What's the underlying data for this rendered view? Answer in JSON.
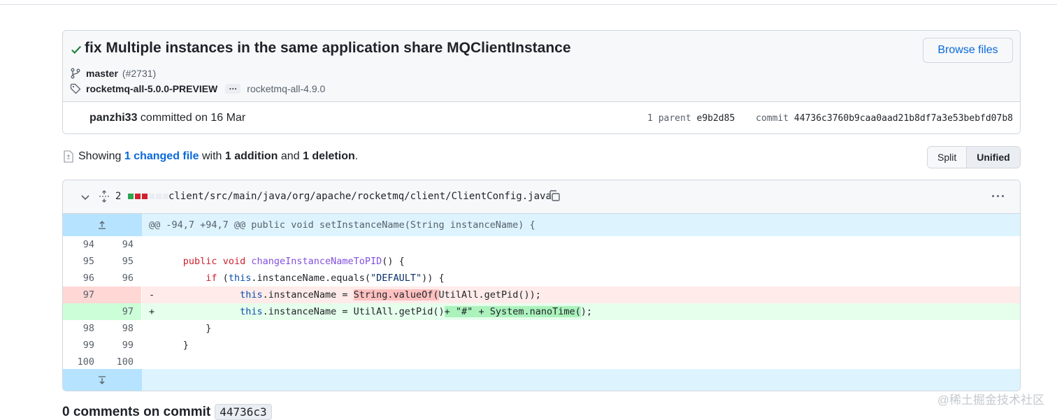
{
  "commit": {
    "title": "fix Multiple instances in the same application share MQClientInstance",
    "browse_label": "Browse files",
    "branch": "master",
    "pr": "(#2731)",
    "tag_first": "rocketmq-all-5.0.0-PREVIEW",
    "tag_more": "…",
    "tag_last": "rocketmq-all-4.9.0",
    "author": "panzhi33",
    "committed_text": "committed on 16 Mar",
    "parent_label": "1 parent",
    "parent_sha": "e9b2d85",
    "commit_label": "commit",
    "commit_sha": "44736c3760b9caa0aad21b8df7a3e53bebfd07b8"
  },
  "summary": {
    "showing": "Showing",
    "changed": "1 changed file",
    "with": "with",
    "additions": "1 addition",
    "and": "and",
    "deletions": "1 deletion",
    "period": "."
  },
  "view_toggle": {
    "split": "Split",
    "unified": "Unified"
  },
  "file": {
    "count": "2",
    "path": "client/src/main/java/org/apache/rocketmq/client/ClientConfig.java",
    "more": "···",
    "diffstat_colors": [
      "#2da44e",
      "#cf222e",
      "#cf222e",
      "#eaeef2",
      "#eaeef2",
      "#eaeef2"
    ]
  },
  "diff": {
    "hunk_header": "@@ -94,7 +94,7 @@ public void setInstanceName(String instanceName) {",
    "line_numbers": {
      "l94": "94",
      "l95": "95",
      "l96": "96",
      "l97": "97",
      "l98": "98",
      "l99": "99",
      "l100": "100"
    },
    "tokens": {
      "public": "public",
      "void": "void",
      "method": "changeInstanceNameToPID",
      "method_tail": "() {",
      "if": "if",
      "this": "this",
      "equals_a": ".instanceName.equals(",
      "default_str": "\"DEFAULT\"",
      "equals_b": ")) {",
      "minus": "-",
      "plus": "+",
      "assign": ".instanceName = ",
      "del_hl": "String.valueOf(",
      "del_tail": "UtilAll.getPid());",
      "add_mid": "UtilAll.getPid()",
      "add_hl": "+ \"#\" + System.nanoTime(",
      "add_tail": ");",
      "close_brace": "}"
    }
  },
  "footer": {
    "comments_title": "0 comments on commit",
    "short_sha": "44736c3",
    "watermark": "@稀土掘金技术社区"
  },
  "colors": {
    "accent": "#0969da",
    "added": "#2da44e",
    "deleted": "#cf222e"
  }
}
